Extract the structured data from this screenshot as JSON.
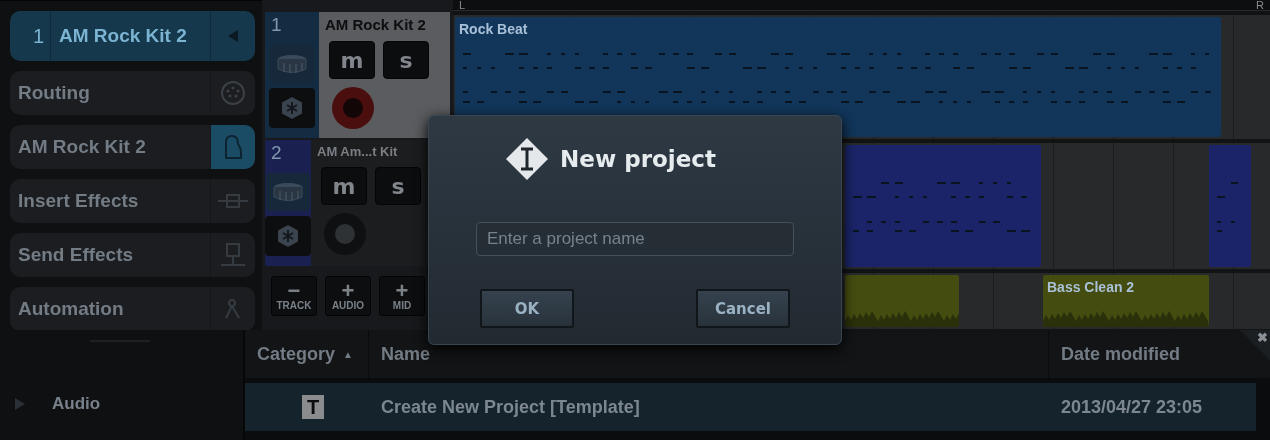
{
  "inspector": [
    {
      "kind": "track",
      "number": "1",
      "label": "AM Rock Kit 2",
      "selected": true,
      "icon_active": false
    },
    {
      "kind": "routing",
      "label": "Routing",
      "selected": false,
      "icon_active": false
    },
    {
      "kind": "instrument",
      "label": "AM Rock Kit 2",
      "selected": false,
      "icon_active": true
    },
    {
      "kind": "insert",
      "label": "Insert Effects",
      "selected": false,
      "icon_active": false
    },
    {
      "kind": "send",
      "label": "Send Effects",
      "selected": false,
      "icon_active": false
    },
    {
      "kind": "automation",
      "label": "Automation",
      "selected": false,
      "icon_active": false
    }
  ],
  "tracks": [
    {
      "number": "1",
      "name": "AM Rock Kit 2",
      "selected": true,
      "record_armed": true,
      "mute": "m",
      "solo": "s"
    },
    {
      "number": "2",
      "name": "AM Am...t Kit",
      "selected": false,
      "record_armed": false,
      "mute": "m",
      "solo": "s"
    }
  ],
  "track_buttons": [
    {
      "sign": "−",
      "label": "TRACK"
    },
    {
      "sign": "+",
      "label": "AUDIO"
    },
    {
      "sign": "+",
      "label": "MID"
    }
  ],
  "ruler": {
    "left": "L",
    "right": "R"
  },
  "lanes": [
    {
      "clips": [
        {
          "kind": "midi",
          "label": "Rock Beat",
          "color": "#11365a"
        }
      ]
    },
    {
      "clips": [
        {
          "kind": "midi",
          "color": "#1b2468"
        },
        {
          "kind": "midi",
          "color": "#1b2468"
        }
      ]
    },
    {
      "clips": [
        {
          "kind": "audio",
          "color": "#454c10"
        },
        {
          "kind": "audio",
          "label": "Bass Clean 2",
          "color": "#454c10"
        }
      ]
    }
  ],
  "browser": {
    "folders": [
      {
        "label": "Audio",
        "expanded": false
      }
    ],
    "columns": [
      {
        "label": "Category",
        "sorted": true
      },
      {
        "label": "Name",
        "sorted": false
      },
      {
        "label": "Date modified",
        "sorted": false
      }
    ],
    "sort_mark": "▲",
    "rows": [
      {
        "category": "T",
        "name": "Create New Project [Template]",
        "date": "2013/04/27 23:05",
        "selected": true
      }
    ],
    "close": "✖"
  },
  "dialog": {
    "title": "New project",
    "placeholder": "Enter a project name",
    "buttons": [
      "OK",
      "Cancel"
    ]
  }
}
